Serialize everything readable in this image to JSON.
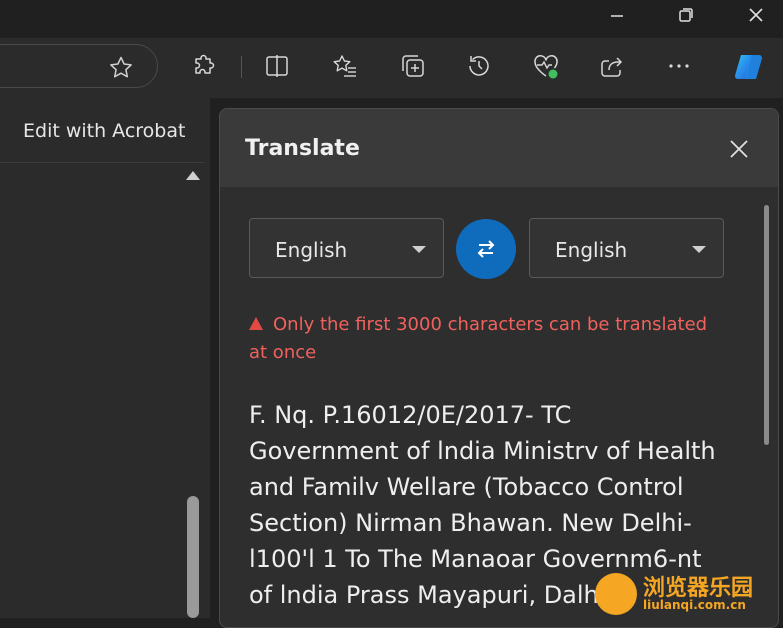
{
  "sidebar": {
    "edit_with_acrobat": "Edit with Acrobat"
  },
  "translate_panel": {
    "title": "Translate",
    "source_language": "English",
    "target_language": "English",
    "warning": "Only the first 3000 characters can be translated at once",
    "source_text": "F. Nq. P.16012/0E/2017- TC\nGovernment of lndia Ministrv of Health and Familv Wellare (Tobacco Control Section) Nirman Bhawan. New Delhi-l100'l 1 To The Manaoar Governm6-nt of lndia Prass Mayapuri, Dalhi-tl"
  },
  "watermark": {
    "text": "浏览器乐园",
    "url": "liulanqi.com.cn"
  },
  "colors": {
    "accent": "#0f6cbd",
    "warning": "#f0625d",
    "background": "#202020",
    "watermark": "#f5a623"
  },
  "icons": [
    "minimize-icon",
    "maximize-icon",
    "close-icon",
    "star-icon",
    "extensions-icon",
    "split-screen-icon",
    "favorites-icon",
    "collections-icon",
    "history-icon",
    "browser-essentials-icon",
    "share-icon",
    "more-icon",
    "copilot-icon",
    "swap-icon",
    "warning-icon"
  ]
}
